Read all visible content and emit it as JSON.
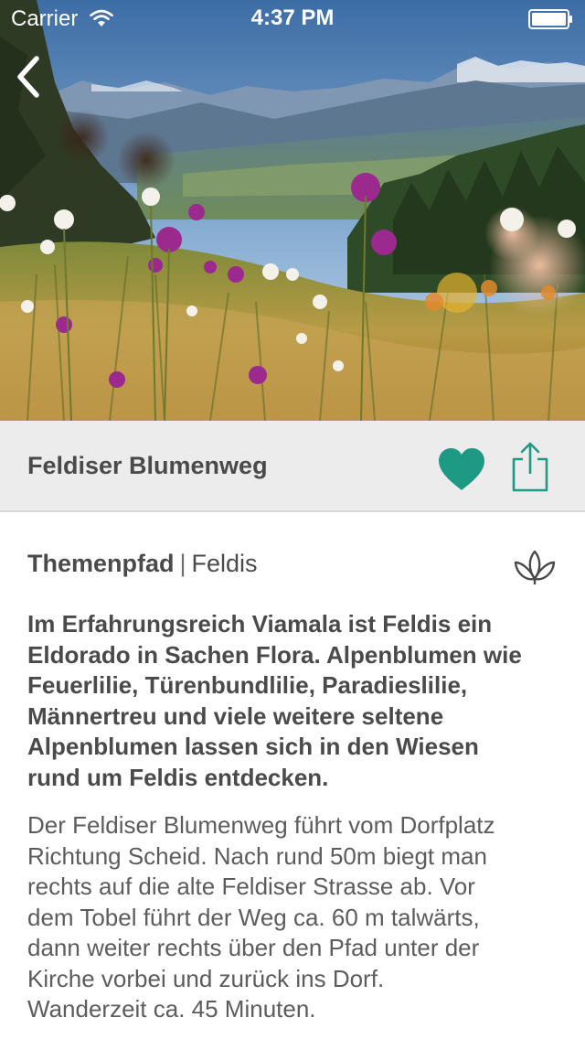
{
  "status_bar": {
    "carrier": "Carrier",
    "time": "4:37 PM"
  },
  "icons": {
    "back": "chevron-left-icon",
    "wifi": "wifi-icon",
    "battery": "battery-icon",
    "favorite": "heart-icon",
    "share": "share-icon",
    "category": "plant-icon"
  },
  "colors": {
    "accent": "#1e9a84",
    "title_bar_bg": "#ececec",
    "text_dark": "#4a4a4a"
  },
  "header": {
    "title": "Feldiser Blumenweg"
  },
  "meta": {
    "category": "Themenpfad",
    "separator": "|",
    "location": "Feldis"
  },
  "content": {
    "lead_lines": [
      "Im Erfahrungsreich Viamala ist Feldis ein",
      "Eldorado in Sachen Flora. Alpenblumen wie",
      "Feuerlilie, Türenbundlilie, Paradieslilie,",
      "Männertreu und viele weitere seltene",
      "Alpenblumen lassen sich in den Wiesen",
      "rund um Feldis entdecken."
    ],
    "body_lines": [
      "Der Feldiser Blumenweg führt vom Dorfplatz",
      "Richtung Scheid. Nach rund 50m biegt man",
      "rechts auf die alte Feldiser Strasse ab. Vor",
      "dem Tobel führt der Weg ca. 60 m talwärts,",
      "dann weiter rechts über den Pfad unter der",
      "Kirche vorbei und zurück ins Dorf.",
      "Wanderzeit ca. 45 Minuten."
    ]
  }
}
